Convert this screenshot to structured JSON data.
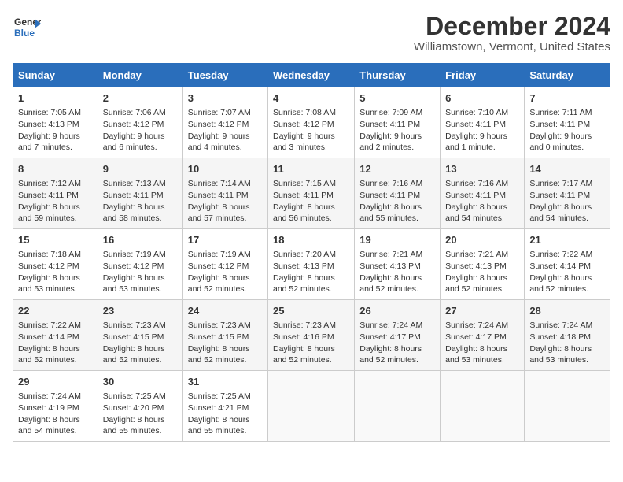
{
  "header": {
    "logo_line1": "General",
    "logo_line2": "Blue",
    "month_title": "December 2024",
    "location": "Williamstown, Vermont, United States"
  },
  "days_of_week": [
    "Sunday",
    "Monday",
    "Tuesday",
    "Wednesday",
    "Thursday",
    "Friday",
    "Saturday"
  ],
  "weeks": [
    [
      {
        "day": "1",
        "sunrise": "7:05 AM",
        "sunset": "4:13 PM",
        "daylight": "9 hours and 7 minutes."
      },
      {
        "day": "2",
        "sunrise": "7:06 AM",
        "sunset": "4:12 PM",
        "daylight": "9 hours and 6 minutes."
      },
      {
        "day": "3",
        "sunrise": "7:07 AM",
        "sunset": "4:12 PM",
        "daylight": "9 hours and 4 minutes."
      },
      {
        "day": "4",
        "sunrise": "7:08 AM",
        "sunset": "4:12 PM",
        "daylight": "9 hours and 3 minutes."
      },
      {
        "day": "5",
        "sunrise": "7:09 AM",
        "sunset": "4:11 PM",
        "daylight": "9 hours and 2 minutes."
      },
      {
        "day": "6",
        "sunrise": "7:10 AM",
        "sunset": "4:11 PM",
        "daylight": "9 hours and 1 minute."
      },
      {
        "day": "7",
        "sunrise": "7:11 AM",
        "sunset": "4:11 PM",
        "daylight": "9 hours and 0 minutes."
      }
    ],
    [
      {
        "day": "8",
        "sunrise": "7:12 AM",
        "sunset": "4:11 PM",
        "daylight": "8 hours and 59 minutes."
      },
      {
        "day": "9",
        "sunrise": "7:13 AM",
        "sunset": "4:11 PM",
        "daylight": "8 hours and 58 minutes."
      },
      {
        "day": "10",
        "sunrise": "7:14 AM",
        "sunset": "4:11 PM",
        "daylight": "8 hours and 57 minutes."
      },
      {
        "day": "11",
        "sunrise": "7:15 AM",
        "sunset": "4:11 PM",
        "daylight": "8 hours and 56 minutes."
      },
      {
        "day": "12",
        "sunrise": "7:16 AM",
        "sunset": "4:11 PM",
        "daylight": "8 hours and 55 minutes."
      },
      {
        "day": "13",
        "sunrise": "7:16 AM",
        "sunset": "4:11 PM",
        "daylight": "8 hours and 54 minutes."
      },
      {
        "day": "14",
        "sunrise": "7:17 AM",
        "sunset": "4:11 PM",
        "daylight": "8 hours and 54 minutes."
      }
    ],
    [
      {
        "day": "15",
        "sunrise": "7:18 AM",
        "sunset": "4:12 PM",
        "daylight": "8 hours and 53 minutes."
      },
      {
        "day": "16",
        "sunrise": "7:19 AM",
        "sunset": "4:12 PM",
        "daylight": "8 hours and 53 minutes."
      },
      {
        "day": "17",
        "sunrise": "7:19 AM",
        "sunset": "4:12 PM",
        "daylight": "8 hours and 52 minutes."
      },
      {
        "day": "18",
        "sunrise": "7:20 AM",
        "sunset": "4:13 PM",
        "daylight": "8 hours and 52 minutes."
      },
      {
        "day": "19",
        "sunrise": "7:21 AM",
        "sunset": "4:13 PM",
        "daylight": "8 hours and 52 minutes."
      },
      {
        "day": "20",
        "sunrise": "7:21 AM",
        "sunset": "4:13 PM",
        "daylight": "8 hours and 52 minutes."
      },
      {
        "day": "21",
        "sunrise": "7:22 AM",
        "sunset": "4:14 PM",
        "daylight": "8 hours and 52 minutes."
      }
    ],
    [
      {
        "day": "22",
        "sunrise": "7:22 AM",
        "sunset": "4:14 PM",
        "daylight": "8 hours and 52 minutes."
      },
      {
        "day": "23",
        "sunrise": "7:23 AM",
        "sunset": "4:15 PM",
        "daylight": "8 hours and 52 minutes."
      },
      {
        "day": "24",
        "sunrise": "7:23 AM",
        "sunset": "4:15 PM",
        "daylight": "8 hours and 52 minutes."
      },
      {
        "day": "25",
        "sunrise": "7:23 AM",
        "sunset": "4:16 PM",
        "daylight": "8 hours and 52 minutes."
      },
      {
        "day": "26",
        "sunrise": "7:24 AM",
        "sunset": "4:17 PM",
        "daylight": "8 hours and 52 minutes."
      },
      {
        "day": "27",
        "sunrise": "7:24 AM",
        "sunset": "4:17 PM",
        "daylight": "8 hours and 53 minutes."
      },
      {
        "day": "28",
        "sunrise": "7:24 AM",
        "sunset": "4:18 PM",
        "daylight": "8 hours and 53 minutes."
      }
    ],
    [
      {
        "day": "29",
        "sunrise": "7:24 AM",
        "sunset": "4:19 PM",
        "daylight": "8 hours and 54 minutes."
      },
      {
        "day": "30",
        "sunrise": "7:25 AM",
        "sunset": "4:20 PM",
        "daylight": "8 hours and 55 minutes."
      },
      {
        "day": "31",
        "sunrise": "7:25 AM",
        "sunset": "4:21 PM",
        "daylight": "8 hours and 55 minutes."
      },
      null,
      null,
      null,
      null
    ]
  ],
  "labels": {
    "sunrise": "Sunrise:",
    "sunset": "Sunset:",
    "daylight": "Daylight:"
  }
}
